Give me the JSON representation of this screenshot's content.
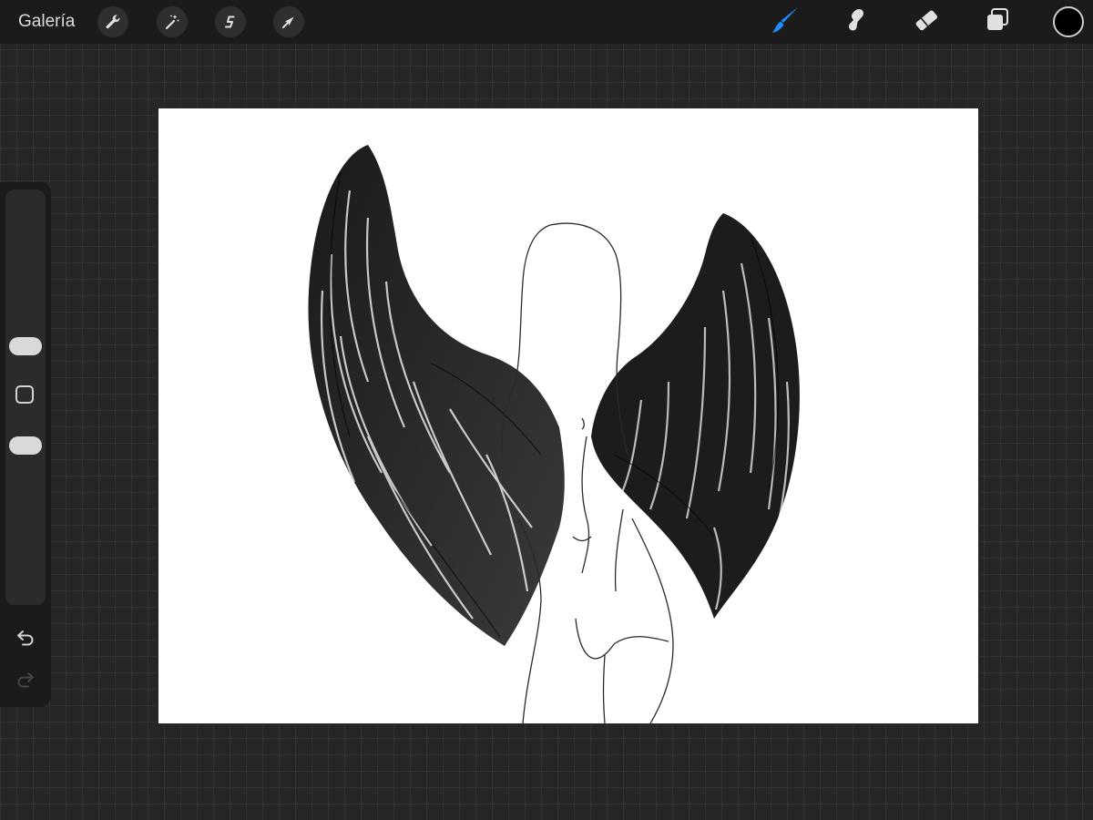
{
  "app": {
    "gallery_label": "Galería"
  },
  "toolbar_left": {
    "icons": [
      "wrench-icon",
      "magic-wand-icon",
      "selection-icon",
      "transform-arrow-icon"
    ]
  },
  "toolbar_right": {
    "icons": [
      "brush-icon",
      "smudge-icon",
      "eraser-icon",
      "layers-icon"
    ],
    "active_tool": "brush",
    "active_color": "#000000",
    "accent_color": "#1f8cff"
  },
  "sidebar": {
    "controls": [
      "brush-size-slider",
      "modify-button",
      "opacity-slider",
      "undo-button",
      "redo-button"
    ]
  },
  "canvas": {
    "background": "#ffffff",
    "drawing_subject": "angel-wings-figure-sketch"
  }
}
